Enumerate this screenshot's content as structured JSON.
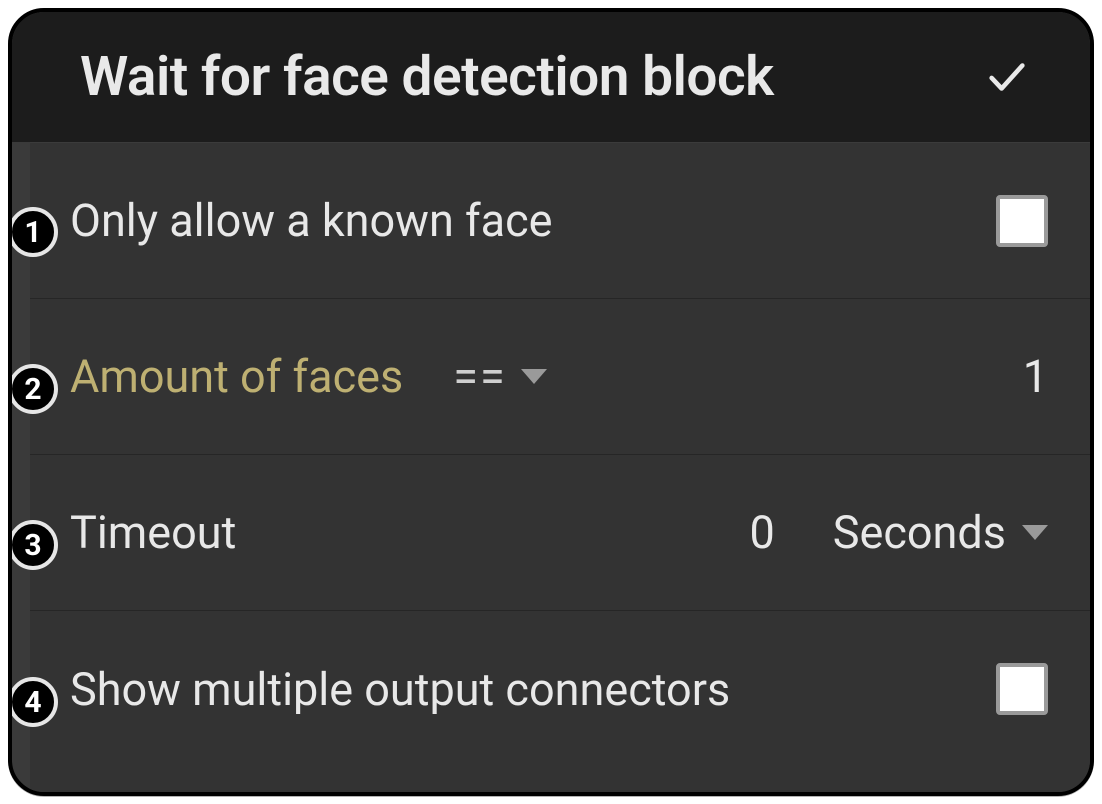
{
  "header": {
    "title": "Wait for face detection block"
  },
  "badges": {
    "b1": "1",
    "b2": "2",
    "b3": "3",
    "b4": "4"
  },
  "rows": {
    "row1": {
      "label": "Only allow a known face",
      "checked": false
    },
    "row2": {
      "label": "Amount of faces",
      "operator": "==",
      "value": "1"
    },
    "row3": {
      "label": "Timeout",
      "value": "0",
      "unit": "Seconds"
    },
    "row4": {
      "label": "Show multiple output connectors",
      "checked": false
    }
  }
}
